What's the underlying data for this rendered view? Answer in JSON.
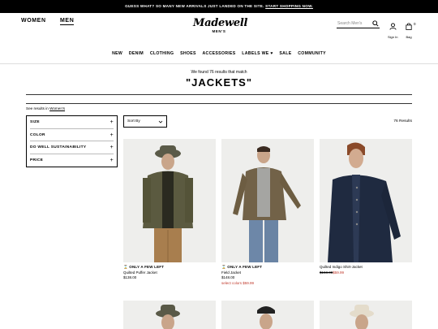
{
  "promo": {
    "text": "GUESS WHAT? SO MANY NEW ARRIVALS JUST LANDED ON THE SITE.",
    "link": "START SHOPPING NOW."
  },
  "header": {
    "women": "WOMEN",
    "men": "MEN",
    "brand": "Madewell",
    "brand_sub": "MEN'S",
    "search_placeholder": "Search Men's",
    "signin": "Sign In",
    "bag": "Bag",
    "bag_count": "0"
  },
  "nav": [
    "NEW",
    "DENIM",
    "CLOTHING",
    "SHOES",
    "ACCESSORIES",
    "LABELS WE ♥",
    "SALE",
    "COMMUNITY"
  ],
  "results": {
    "found_text": "We found 76 results that match",
    "query": "\"JACKETS\"",
    "see_results_prefix": "See results in",
    "see_results_link": "Women's",
    "count": "76 Results"
  },
  "filters": [
    "SIZE",
    "COLOR",
    "DO WELL SUSTAINABILITY",
    "PRICE"
  ],
  "filter_expand": "+",
  "sort": {
    "label": "Sort By"
  },
  "products": [
    {
      "badge": "ONLY A FEW LEFT",
      "name": "Quilted Puffer Jacket",
      "price": "$138.00",
      "orig_price": "",
      "sale_price": "",
      "note": ""
    },
    {
      "badge": "ONLY A FEW LEFT",
      "name": "Field Jacket",
      "price": "$148.00",
      "orig_price": "",
      "sale_price": "",
      "note": "select colors $59.99"
    },
    {
      "badge": "",
      "name": "Quilted Indigo Shirt-Jacket",
      "price": "",
      "orig_price": "$158.00",
      "sale_price": "$59.99",
      "note": ""
    }
  ],
  "colors": {
    "accent_red": "#c0392b",
    "promo_bg": "#000000"
  }
}
